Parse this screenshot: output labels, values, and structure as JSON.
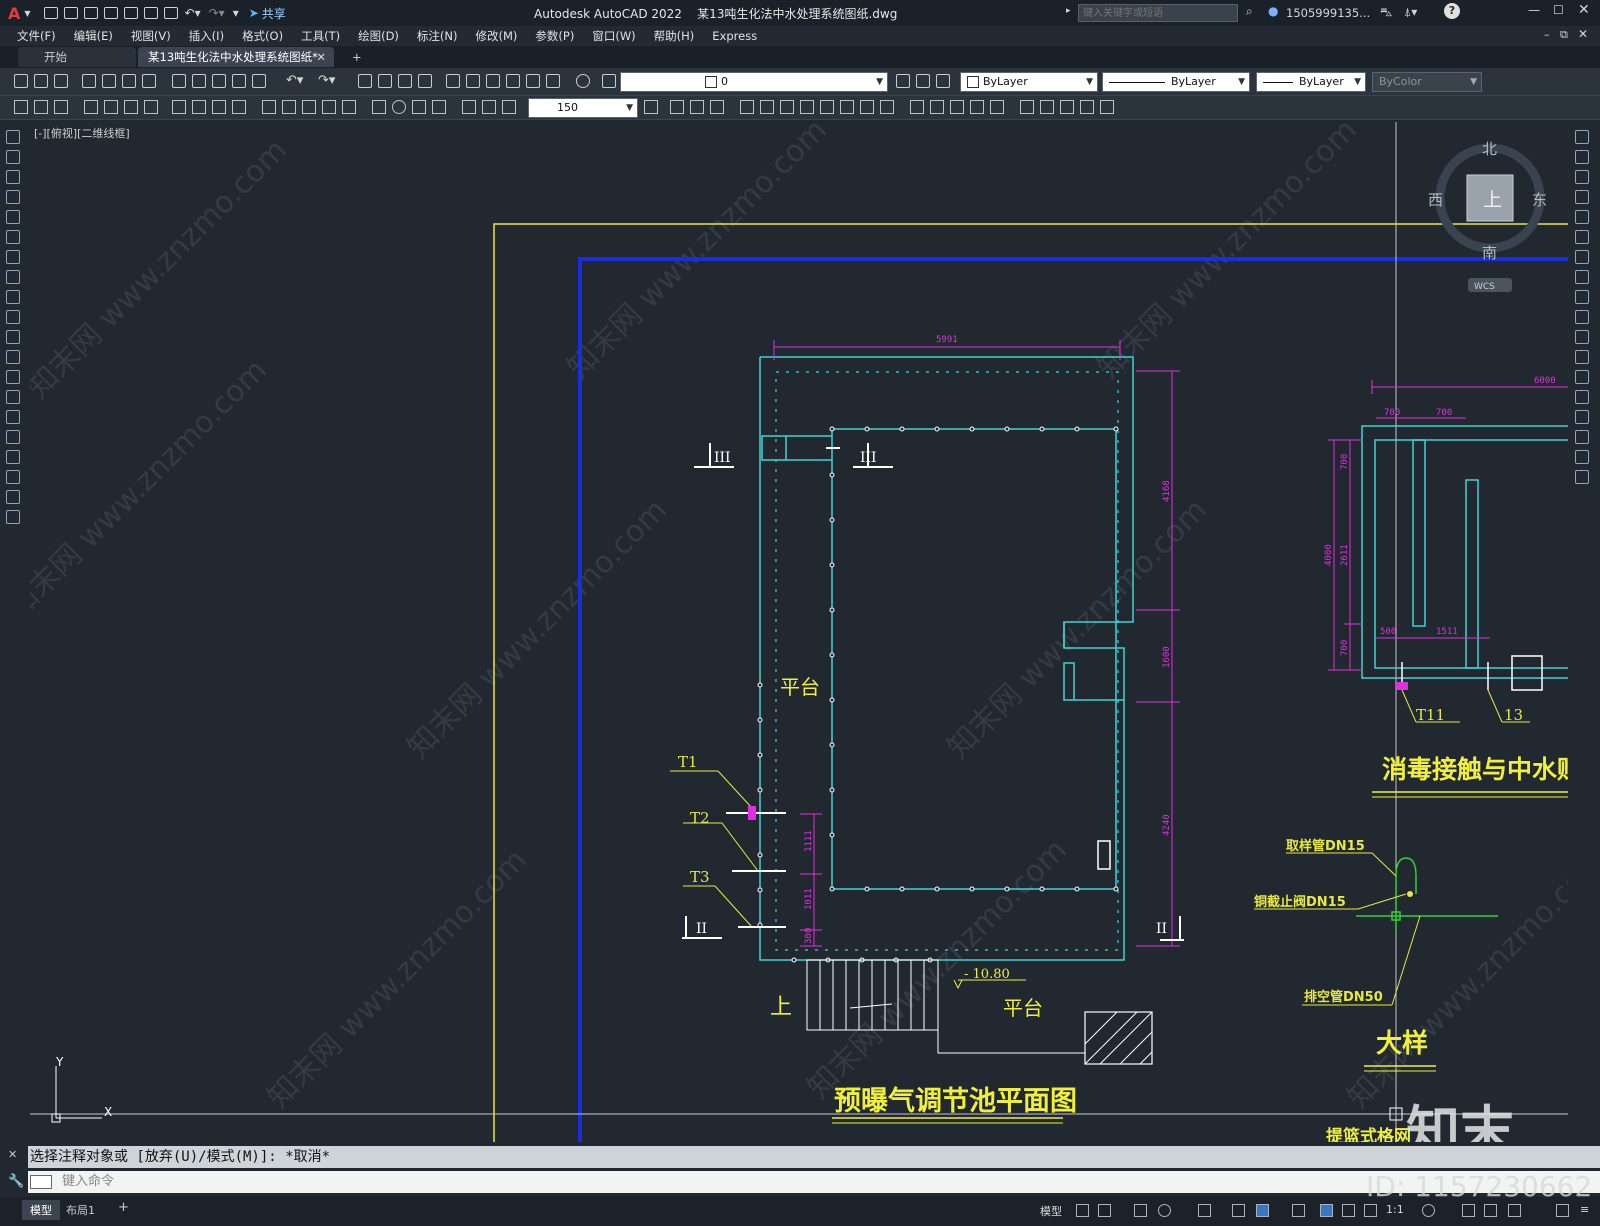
{
  "app": {
    "window_title": "Autodesk AutoCAD 2022    某13吨生化法中水处理系统图纸.dwg",
    "share_label": "共享",
    "search_placeholder": "键入关键字或短语",
    "user": "1505999135...",
    "window_controls": [
      "minimize-icon",
      "maximize-icon",
      "close-icon"
    ]
  },
  "menu": [
    "文件(F)",
    "编辑(E)",
    "视图(V)",
    "插入(I)",
    "格式(O)",
    "工具(T)",
    "绘图(D)",
    "标注(N)",
    "修改(M)",
    "参数(P)",
    "窗口(W)",
    "帮助(H)",
    "Express"
  ],
  "tabs": {
    "start": "开始",
    "active": "某13吨生化法中水处理系统图纸*",
    "add": "+"
  },
  "toolbar": {
    "layer_value": "0",
    "color": "ByLayer",
    "linetype": "ByLayer",
    "lineweight": "ByLayer",
    "plotstyle": "ByColor",
    "scale": "150"
  },
  "viewport": {
    "label": "[-][俯视][二维线框]"
  },
  "viewcube": {
    "north": "北",
    "south": "南",
    "east": "东",
    "west": "西",
    "top": "上",
    "wcs": "WCS"
  },
  "drawing": {
    "dim_top": "5991",
    "dim_right": [
      "4168",
      "1600",
      "4240"
    ],
    "dim_left": [
      "1111",
      "1011",
      "300"
    ],
    "section_iii": "III",
    "section_ii": "II",
    "labels": [
      "T1",
      "T2",
      "T3"
    ],
    "platform": "平台",
    "platform2": "平台",
    "up": "上",
    "elev": "- 10.80",
    "title_main": "预曝气调节池平面图",
    "right_dim_top": "6000",
    "right_dims_a": [
      "700",
      "700"
    ],
    "right_dims_v": [
      "700",
      "4000",
      "2611",
      "700"
    ],
    "right_dims_b": [
      "500",
      "1511"
    ],
    "t11": "T11",
    "t13": "13",
    "title_right": "消毒接触与中水贮",
    "detail": {
      "sample": "取样管DN15",
      "valve": "铜截止阀DN15",
      "drain": "排空管DN50",
      "title": "大样"
    },
    "bottom_cut": "提篮式格网"
  },
  "axis": {
    "y": "Y",
    "x": "X"
  },
  "command": {
    "history": "选择注释对象或 [放弃(U)/模式(M)]: *取消*",
    "placeholder": "键入命令"
  },
  "status": {
    "model_tab": "模型",
    "layout_tab": "布局1",
    "add": "+",
    "model": "模型",
    "scale": "1:1"
  },
  "watermark": {
    "text": "知末网 www.znzmo.com",
    "logo": "知末",
    "id": "ID: 1157230662"
  },
  "colors": {
    "background": "#212830",
    "cyan": "#3fd2d8",
    "magenta": "#e02fe0",
    "yellow": "#f0f03a",
    "blue": "#1a2ee0",
    "white": "#ffffff",
    "green": "#2fd22f"
  }
}
